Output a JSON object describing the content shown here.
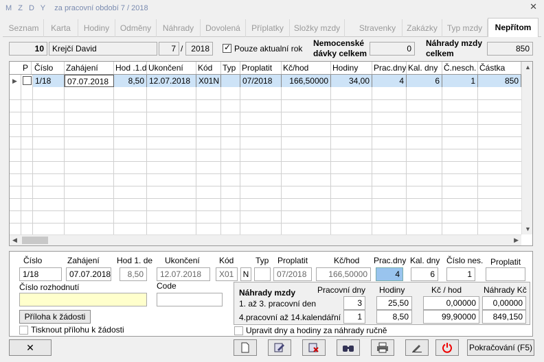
{
  "window": {
    "title_prefix": "M Z D Y",
    "title_suffix": "za pracovní období  7 / 2018",
    "close_glyph": "✕"
  },
  "tabs": [
    "Seznam",
    "Karta",
    "Hodiny",
    "Odměny",
    "Náhrady",
    "Dovolená",
    "Příplatky",
    "Složky mzdy",
    "Stravenky",
    "Zakázky",
    "Typ mzdy",
    "Nepřítom"
  ],
  "header": {
    "emp_no": "10",
    "emp_name": "Krejčí David",
    "month": "7",
    "sep": "/",
    "year": "2018",
    "current_year_label": "Pouze aktualní rok",
    "sick_label1": "Nemocenské",
    "sick_label2": "dávky celkem",
    "sick_value": "0",
    "comp_label1": "Náhrady mzdy",
    "comp_label2": "celkem",
    "comp_value": "850"
  },
  "grid": {
    "columns": [
      "P",
      "Číslo",
      "Zahájení",
      "Hod .1.d",
      "Ukončení",
      "Kód",
      "Typ",
      "Proplatit",
      "Kč/hod",
      "Hodiny",
      "Prac.dny",
      "Kal. dny",
      "Č.nesch.",
      "Částka"
    ],
    "row": {
      "cislo": "1/18",
      "zahajeni": "07.07.2018",
      "hod": "8,50",
      "ukonceni": "12.07.2018",
      "kod": "X01N",
      "typ": "",
      "proplatit": "07/2018",
      "kchod": "166,50000",
      "hodiny": "34,00",
      "pracdny": "4",
      "kaldny": "6",
      "cnesch": "1",
      "castka": "850"
    }
  },
  "detail": {
    "labels": {
      "cislo": "Číslo",
      "zahajeni": "Zahájení",
      "hod1": "Hod 1. de",
      "ukonceni": "Ukončení",
      "kod": "Kód",
      "typ": "Typ",
      "proplatit": "Proplatit",
      "kchod": "Kč/hod",
      "pracdny": "Prac.dny",
      "kaldny": "Kal. dny",
      "cisloNes": "Číslo nes.",
      "proplatit2": "Proplatit",
      "rozhodnuti": "Číslo rozhodnutí",
      "code": "Code"
    },
    "values": {
      "cislo": "1/18",
      "zahajeni": "07.07.2018",
      "hod1": "8,50",
      "ukonceni": "12.07.2018",
      "kod": "X01",
      "n": "N",
      "typ": "",
      "proplatit": "07/2018",
      "kchod": "166,50000",
      "pracdny": "4",
      "kaldny": "6",
      "cisloNes": "1",
      "proplatit2": "",
      "rozhodnuti": "",
      "code": ""
    },
    "attach_button": "Příloha k žádosti",
    "print_attach_label": "Tisknout přílohu k žádosti"
  },
  "comp": {
    "title": "Náhrady mzdy",
    "col_days": "Pracovní dny",
    "col_hours": "Hodiny",
    "col_rate": "Kč / hod",
    "col_amount": "Náhrady Kč",
    "row1_label": "1. až 3. pracovní den",
    "row1_days": "3",
    "row1_hours": "25,50",
    "row1_rate": "0,00000",
    "row1_amount": "0,00000",
    "row2_label": "4.pracovní až 14.kalendářní",
    "row2_days": "1",
    "row2_hours": "8,50",
    "row2_rate": "99,90000",
    "row2_amount": "849,150",
    "manual_label": "Upravit dny a hodiny za náhrady ručně"
  },
  "toolbar": {
    "delete_glyph": "✕",
    "continue_label": "Pokračování (F5)"
  },
  "colors": {
    "accent_blue": "#99c4ee",
    "title": "#7a8bb0",
    "selected_row": "#cde3f7",
    "highlight_field": "#ffffcc"
  }
}
